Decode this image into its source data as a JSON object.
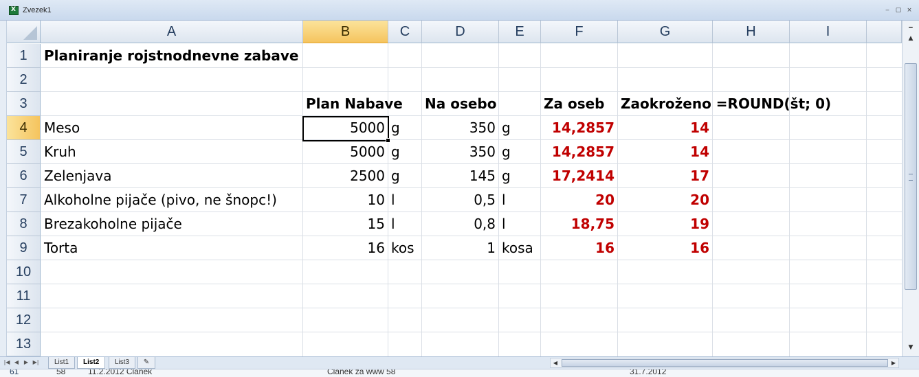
{
  "window": {
    "title": "Zvezek1",
    "controls": [
      "‒",
      "▢",
      "×"
    ]
  },
  "columns": [
    "A",
    "B",
    "C",
    "D",
    "E",
    "F",
    "G",
    "H",
    "I"
  ],
  "rows": [
    "1",
    "2",
    "3",
    "4",
    "5",
    "6",
    "7",
    "8",
    "9",
    "10",
    "11",
    "12",
    "13"
  ],
  "cells": {
    "title": "Planiranje rojstnodnevne zabave",
    "headers": {
      "plan": "Plan Nabave",
      "per_person": "Na osebo",
      "for_people": "Za oseb",
      "rounded": "Zaokroženo =ROUND(št; 0)"
    },
    "items": [
      {
        "name": "Meso",
        "plan": "5000",
        "unit": "g",
        "per": "350",
        "unit2": "g",
        "for": "14,2857",
        "rounded": "14"
      },
      {
        "name": "Kruh",
        "plan": "5000",
        "unit": "g",
        "per": "350",
        "unit2": "g",
        "for": "14,2857",
        "rounded": "14"
      },
      {
        "name": "Zelenjava",
        "plan": "2500",
        "unit": "g",
        "per": "145",
        "unit2": "g",
        "for": "17,2414",
        "rounded": "17"
      },
      {
        "name": "Alkoholne pijače (pivo, ne šnopc!)",
        "plan": "10",
        "unit": "l",
        "per": "0,5",
        "unit2": "l",
        "for": "20",
        "rounded": "20"
      },
      {
        "name": "Brezakoholne pijače",
        "plan": "15",
        "unit": "l",
        "per": "0,8",
        "unit2": "l",
        "for": "18,75",
        "rounded": "19"
      },
      {
        "name": "Torta",
        "plan": "16",
        "unit": "kos",
        "per": "1",
        "unit2": "kosa",
        "for": "16",
        "rounded": "16"
      }
    ]
  },
  "selected_cell": "B4",
  "sheet_tabs": [
    "List1",
    "List2",
    "List3"
  ],
  "active_sheet": "List2",
  "background_window_row": {
    "row": "61",
    "num": "58",
    "date": "11.2.2012 Članek",
    "desc": "Članek za www 58",
    "date2": "31.7.2012"
  }
}
